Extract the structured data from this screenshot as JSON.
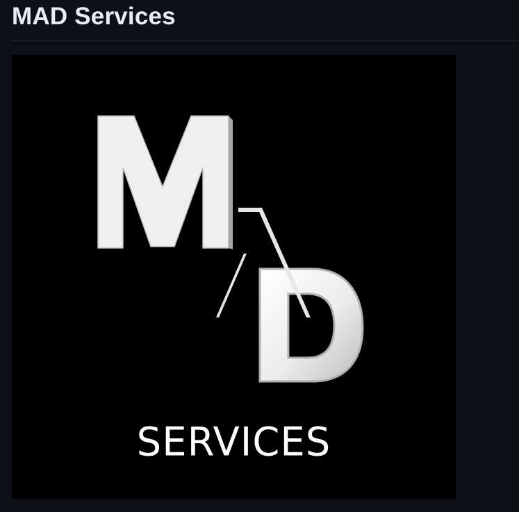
{
  "page": {
    "title": "MAD Services"
  },
  "logo": {
    "caption": "SERVICES",
    "letters": [
      "M",
      "D"
    ],
    "colors": {
      "background": "#000000",
      "letter_fill": "#eeeeee",
      "letter_edge": "#9a9a9a"
    }
  }
}
